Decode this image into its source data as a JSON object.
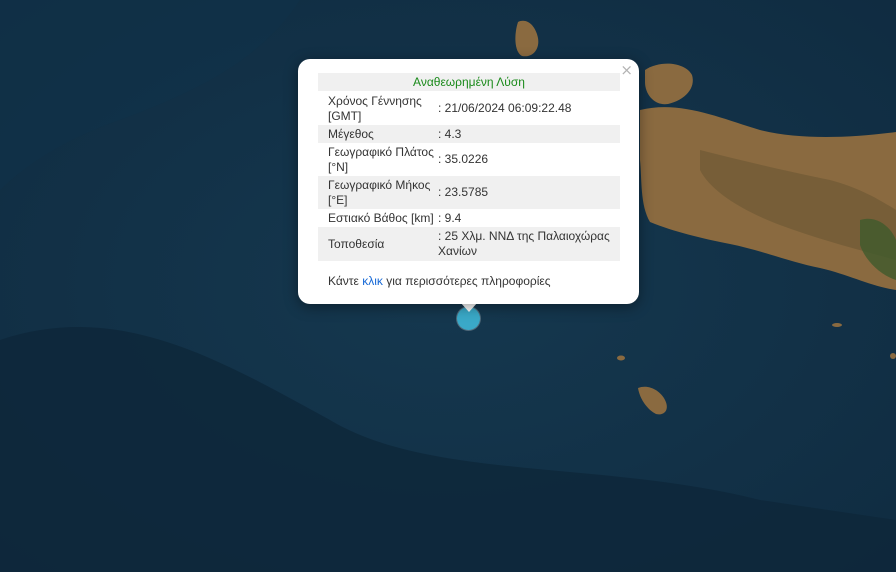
{
  "popup": {
    "title": "Αναθεωρημένη Λύση",
    "close_symbol": "×",
    "rows": [
      {
        "label": "Χρόνος Γέννησης [GMT]",
        "value": ": 21/06/2024 06:09:22.48"
      },
      {
        "label": "Μέγεθος",
        "value": ": 4.3"
      },
      {
        "label": "Γεωγραφικό Πλάτος [°N]",
        "value": ": 35.0226"
      },
      {
        "label": "Γεωγραφικό Μήκος [°E]",
        "value": ": 23.5785"
      },
      {
        "label": "Εστιακό Βάθος [km]",
        "value": ": 9.4"
      },
      {
        "label": "Τοποθεσία",
        "value": ": 25 Χλμ. ΝΝΔ της Παλαιοχώρας Χανίων"
      }
    ],
    "footer_prefix": "Κάντε",
    "footer_link": "κλικ",
    "footer_suffix": "για περισσότερες πληροφορίες"
  },
  "colors": {
    "sea": "#123047",
    "land": "#8a6a40",
    "title_text": "#1a8a1a",
    "link": "#1769d6",
    "marker": "#3aa9c8"
  },
  "marker": {
    "icon": "earthquake-epicenter-dot"
  }
}
